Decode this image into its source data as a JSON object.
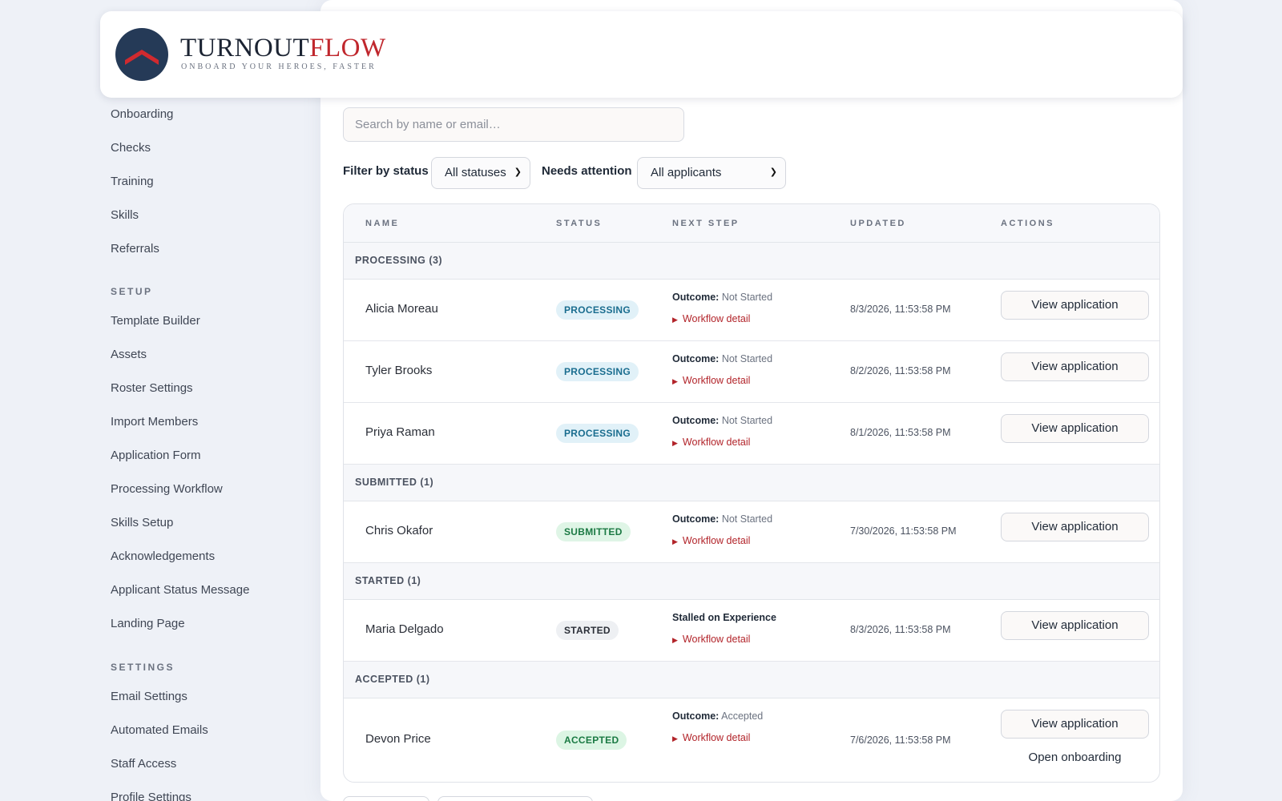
{
  "brand": {
    "word_dark": "TURNOUT",
    "word_red": "FLOW",
    "tagline": "ONBOARD YOUR HEROES, FASTER"
  },
  "sidebar": {
    "top_items": [
      "Onboarding",
      "Checks",
      "Training",
      "Skills",
      "Referrals"
    ],
    "setup_heading": "SETUP",
    "setup_items": [
      "Template Builder",
      "Assets",
      "Roster Settings",
      "Import Members",
      "Application Form",
      "Processing Workflow",
      "Skills Setup",
      "Acknowledgements",
      "Applicant Status Message",
      "Landing Page"
    ],
    "settings_heading": "SETTINGS",
    "settings_items": [
      "Email Settings",
      "Automated Emails",
      "Staff Access",
      "Profile Settings"
    ]
  },
  "search": {
    "placeholder": "Search by name or email…"
  },
  "filters": {
    "status_label": "Filter by status",
    "status_value": "All statuses",
    "attention_label": "Needs attention",
    "attention_value": "All applicants"
  },
  "table": {
    "columns": [
      "NAME",
      "STATUS",
      "NEXT STEP",
      "UPDATED",
      "ACTIONS"
    ],
    "groups": [
      "PROCESSING (3)",
      "SUBMITTED (1)",
      "STARTED (1)",
      "ACCEPTED (1)"
    ],
    "workflow_label": "Workflow detail",
    "view_label": "View application",
    "onboarding_label": "Open onboarding",
    "rows": [
      {
        "name": "Alicia Moreau",
        "status": "PROCESSING",
        "outcome_label": "Outcome:",
        "outcome_value": "Not Started",
        "updated": "8/3/2026, 11:53:58 PM"
      },
      {
        "name": "Tyler Brooks",
        "status": "PROCESSING",
        "outcome_label": "Outcome:",
        "outcome_value": "Not Started",
        "updated": "8/2/2026, 11:53:58 PM"
      },
      {
        "name": "Priya Raman",
        "status": "PROCESSING",
        "outcome_label": "Outcome:",
        "outcome_value": "Not Started",
        "updated": "8/1/2026, 11:53:58 PM"
      },
      {
        "name": "Chris Okafor",
        "status": "SUBMITTED",
        "outcome_label": "Outcome:",
        "outcome_value": "Not Started",
        "updated": "7/30/2026, 11:53:58 PM"
      },
      {
        "name": "Maria Delgado",
        "status": "STARTED",
        "outcome_label": "Stalled on Experience",
        "outcome_value": "",
        "updated": "8/3/2026, 11:53:58 PM"
      },
      {
        "name": "Devon Price",
        "status": "ACCEPTED",
        "outcome_label": "Outcome:",
        "outcome_value": "Accepted",
        "updated": "7/6/2026, 11:53:58 PM"
      }
    ]
  },
  "colors": {
    "accent_red": "#c0272d",
    "logo_navy": "#253a57",
    "processing_badge": "#e1f1f8",
    "submitted_badge": "#dff5e6"
  }
}
